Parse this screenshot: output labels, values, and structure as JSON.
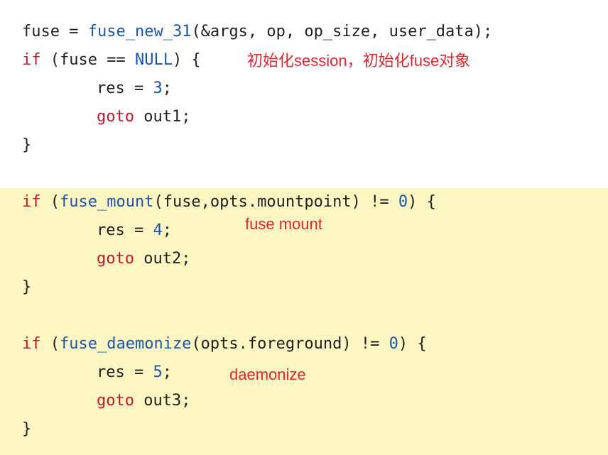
{
  "code": {
    "block1": {
      "line1": {
        "var": "fuse",
        "op": " = ",
        "fn": "fuse_new_31",
        "args": "(&args, op, op_size, user_data);"
      },
      "line2": {
        "kw": "if",
        "pre": " (fuse == ",
        "const": "NULL",
        "post": ") {"
      },
      "line3": {
        "pre": "res = ",
        "num": "3",
        "post": ";"
      },
      "line4": {
        "kw": "goto",
        "post": " out1;"
      },
      "line5": "}"
    },
    "block2": {
      "line1": {
        "kw": "if",
        "pre": " (",
        "fn": "fuse_mount",
        "mid": "(fuse,opts.mountpoint) != ",
        "num": "0",
        "post": ") {"
      },
      "line2": {
        "pre": "res = ",
        "num": "4",
        "post": ";"
      },
      "line3": {
        "kw": "goto",
        "post": " out2;"
      },
      "line4": "}"
    },
    "block3": {
      "line1": {
        "kw": "if",
        "pre": " (",
        "fn": "fuse_daemonize",
        "mid": "(opts.foreground) != ",
        "num": "0",
        "post": ") {"
      },
      "line2": {
        "pre": "res = ",
        "num": "5",
        "post": ";"
      },
      "line3": {
        "kw": "goto",
        "post": " out3;"
      },
      "line4": "}"
    }
  },
  "annotations": {
    "init": "初始化session，初始化fuse对象",
    "mount": "fuse mount",
    "daemonize": "daemonize"
  },
  "colors": {
    "keyword": "#c4172c",
    "function": "#1a56b0",
    "annotation": "#e0262e",
    "highlight_band": "#fdf6c3"
  }
}
